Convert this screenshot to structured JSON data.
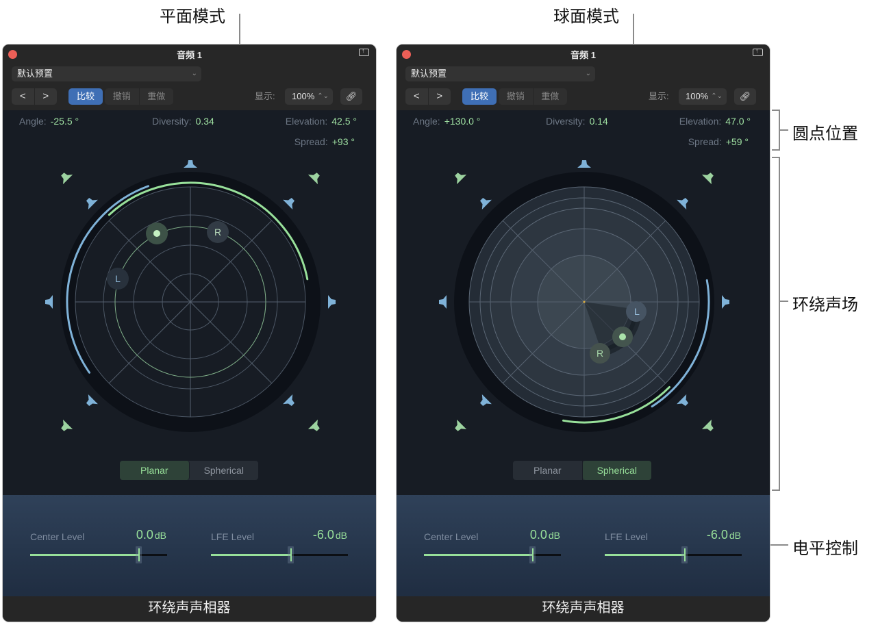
{
  "annotations": {
    "planar_mode": "平面模式",
    "spherical_mode": "球面模式",
    "dot_position": "圆点位置",
    "surround_field": "环绕声场",
    "level_controls": "电平控制"
  },
  "colors": {
    "accent_green": "#98e09a",
    "speaker_blue": "#7fb2d8",
    "speaker_green": "#9dd3a0",
    "compare_blue": "#3f6fb5",
    "close_red": "#ec5f57"
  },
  "panels": [
    {
      "title": "音频 1",
      "preset": "默认预置",
      "nav_prev": "<",
      "nav_next": ">",
      "compare": "比较",
      "undo": "撤销",
      "redo": "重做",
      "view_label": "显示:",
      "zoom": "100%",
      "params": {
        "angle_label": "Angle:",
        "angle": "-25.5 °",
        "diversity_label": "Diversity:",
        "diversity": "0.34",
        "elevation_label": "Elevation:",
        "elevation": "42.5 °",
        "spread_label": "Spread:",
        "spread": "+93 °"
      },
      "mode": "planar",
      "mode_options": [
        "Planar",
        "Spherical"
      ],
      "channel_labels": {
        "left": "L",
        "right": "R"
      },
      "center_level": {
        "label": "Center Level",
        "value": "0.0",
        "unit": "dB",
        "fraction": 0.79
      },
      "lfe_level": {
        "label": "LFE Level",
        "value": "-6.0",
        "unit": "dB",
        "fraction": 0.58
      },
      "footer": "环绕声声相器"
    },
    {
      "title": "音频 1",
      "preset": "默认预置",
      "nav_prev": "<",
      "nav_next": ">",
      "compare": "比较",
      "undo": "撤销",
      "redo": "重做",
      "view_label": "显示:",
      "zoom": "100%",
      "params": {
        "angle_label": "Angle:",
        "angle": "+130.0 °",
        "diversity_label": "Diversity:",
        "diversity": "0.14",
        "elevation_label": "Elevation:",
        "elevation": "47.0 °",
        "spread_label": "Spread:",
        "spread": "+59 °"
      },
      "mode": "spherical",
      "mode_options": [
        "Planar",
        "Spherical"
      ],
      "channel_labels": {
        "left": "L",
        "right": "R"
      },
      "center_level": {
        "label": "Center Level",
        "value": "0.0",
        "unit": "dB",
        "fraction": 0.79
      },
      "lfe_level": {
        "label": "LFE Level",
        "value": "-6.0",
        "unit": "dB",
        "fraction": 0.58
      },
      "footer": "环绕声声相器"
    }
  ]
}
